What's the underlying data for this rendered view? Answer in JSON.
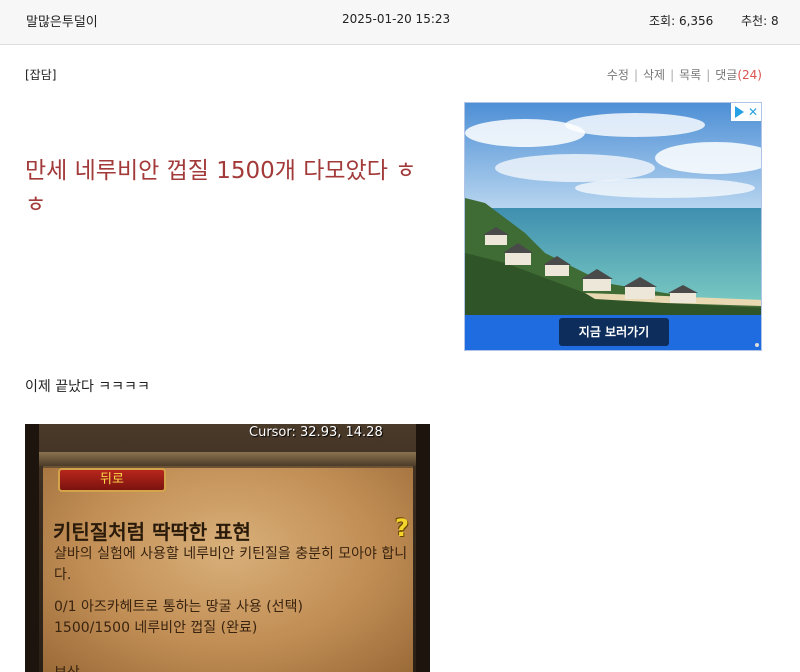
{
  "header": {
    "author": "말많은투덜이",
    "datetime": "2025-01-20 15:23",
    "views_label": "조회: 6,356",
    "recommend_label": "추천: 8"
  },
  "post": {
    "category": "[잡담]",
    "title": "만세 네루비안 껍질 1500개 다모았다 ㅎㅎ",
    "body": "이제 끝났다 ㅋㅋㅋㅋ"
  },
  "actions": {
    "edit": "수정",
    "delete": "삭제",
    "list": "목록",
    "comments": "댓글",
    "comment_count": "(24)",
    "separator": "|"
  },
  "ad": {
    "button_label": "지금 보러가기",
    "close_icon": "x-icon",
    "adchoices_icon": "adchoices-triangle-icon"
  },
  "game_screenshot": {
    "cursor_readout": "Cursor: 32.93, 14.28",
    "back_button": "뒤로",
    "quest_title": "키틴질처럼 딱딱한 표현",
    "quest_description": "샬바의 실험에 사용할 네루비안 키틴질을 충분히 모아야 합니다.",
    "objective_1": "0/1 아즈카헤트로 통하는 땅굴 사용 (선택)",
    "objective_2": "1500/1500 네루비안 껍질 (완료)",
    "quest_icon": "question-mark-icon",
    "more_text": "보상"
  },
  "colors": {
    "title": "#a33a3a",
    "comment_count": "#d9534f",
    "ad_bar": "#1e6ce0",
    "ad_button": "#0d2d5c"
  }
}
